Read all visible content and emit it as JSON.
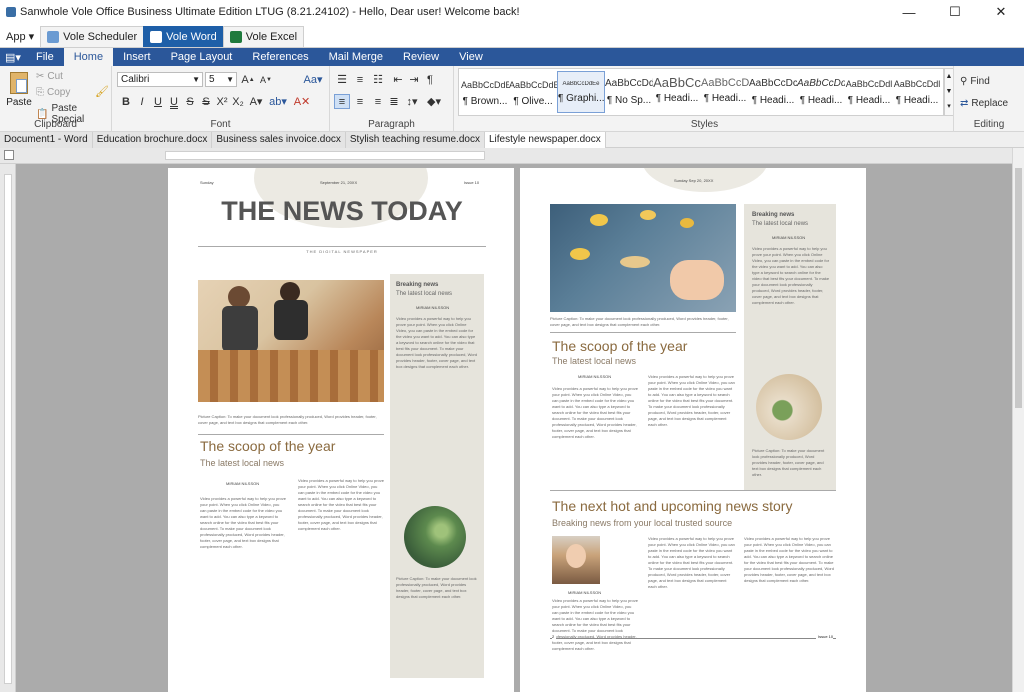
{
  "window": {
    "title": "Sanwhole Vole Office  Business Ultimate Edition LTUG (8.21.24102) - Hello, Dear user! Welcome back!",
    "minimize": "—",
    "maximize": "☐",
    "close": "✕"
  },
  "appbar": {
    "menu": "App",
    "tabs": [
      "Vole Scheduler",
      "Vole Word",
      "Vole Excel"
    ]
  },
  "ribbon_tabs": [
    "File",
    "Home",
    "Insert",
    "Page Layout",
    "References",
    "Mail Merge",
    "Review",
    "View"
  ],
  "clipboard": {
    "paste": "Paste",
    "cut": "Cut",
    "copy": "Copy",
    "paste_special": "Paste Special",
    "label": "Clipboard"
  },
  "font": {
    "name": "Calibri",
    "size": "5",
    "label": "Font"
  },
  "paragraph": {
    "label": "Paragraph"
  },
  "styles": {
    "label": "Styles",
    "items": [
      {
        "preview": "AaBbCcDdEe",
        "name": "¶ Brown..."
      },
      {
        "preview": "AaBbCcDdEe",
        "name": "¶ Olive..."
      },
      {
        "preview": "AaBbCcDdEe",
        "name": "¶ Graphi..."
      },
      {
        "preview": "AaBbCcDdI",
        "name": "¶ No Sp..."
      },
      {
        "preview": "AaBbCc",
        "name": "¶ Headi..."
      },
      {
        "preview": "AaBbCcD",
        "name": "¶ Headi..."
      },
      {
        "preview": "AaBbCcDc",
        "name": "¶ Headi..."
      },
      {
        "preview": "AaBbCcDd",
        "name": "¶ Headi..."
      },
      {
        "preview": "AaBbCcDdl",
        "name": "¶ Headi..."
      },
      {
        "preview": "AaBbCcDdl",
        "name": "¶ Headi..."
      }
    ]
  },
  "editing": {
    "find": "Find",
    "replace": "Replace",
    "label": "Editing"
  },
  "doc_tabs": [
    "Document1 - Word",
    "Education brochure.docx",
    "Business sales invoice.docx",
    "Stylish teaching resume.docx",
    "Lifestyle newspaper.docx"
  ],
  "page1": {
    "day": "Sunday",
    "date": "September 21, 20XX",
    "issue": "Issue 10",
    "masthead": "THE NEWS TODAY",
    "tagline": "THE DIGITAL NEWSPAPER",
    "caption1": "Picture Caption: To make your document look professionally produced, Word provides header, footer, cover page, and text box designs that complement each other.",
    "headline": "The scoop of the year",
    "subhead": "The latest local news",
    "byline": "MIRIAM NILSSON",
    "side_title": "Breaking news",
    "side_sub": "The latest local news",
    "side_byline": "MIRIAM NILSSON",
    "side_caption": "Picture Caption: To make your document look professionally produced, Word provides header, footer, cover page, and text box designs that complement each other.",
    "body": "Video provides a powerful way to help you prove your point. When you click Online Video, you can paste in the embed code for the video you want to add. You can also type a keyword to search online for the video that best fits your document. To make your document look professionally produced, Word provides header, footer, cover page, and text box designs that complement each other."
  },
  "page2": {
    "date": "Sunday Sep 20, 20XX",
    "caption1": "Picture Caption: To make your document look professionally produced, Word provides header, footer, cover page, and text box designs that complement each other.",
    "headline": "The scoop of the year",
    "subhead": "The latest local news",
    "byline": "MIRIAM NILSSON",
    "side_title": "Breaking news",
    "side_sub": "The latest local news",
    "side_byline": "MIRIAM NILSSON",
    "side_caption": "Picture Caption: To make your document look professionally produced, Word provides header, footer, cover page, and text box designs that complement each other.",
    "headline2": "The next hot and upcoming news story",
    "subhead2": "Breaking news from your local trusted source",
    "byline2": "MIRIAM NILSSON",
    "page_num": "2",
    "issue": "Issue 10",
    "body": "Video provides a powerful way to help you prove your point. When you click Online Video, you can paste in the embed code for the video you want to add. You can also type a keyword to search online for the video that best fits your document. To make your document look professionally produced, Word provides header, footer, cover page, and text box designs that complement each other."
  }
}
